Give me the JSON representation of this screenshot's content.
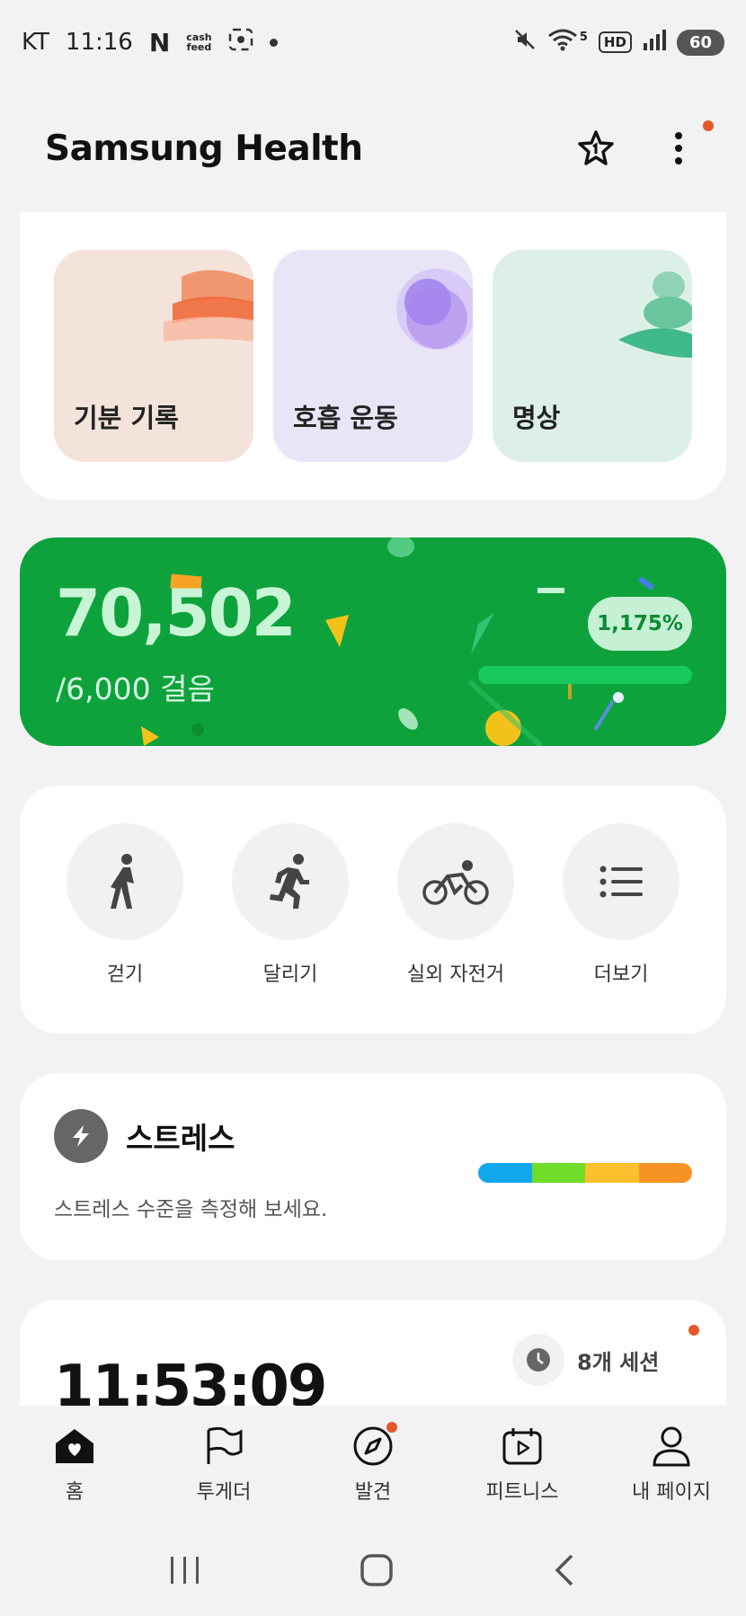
{
  "status_bar": {
    "carrier": "KT",
    "time": "11:16",
    "cashfeed_top": "cash",
    "cashfeed_bottom": "feed",
    "n_logo": "N",
    "hd": "HD",
    "network": "5",
    "battery": "60"
  },
  "header": {
    "title": "Samsung Health"
  },
  "mindfulness": {
    "tiles": [
      {
        "label": "기분 기록"
      },
      {
        "label": "호흡 운동"
      },
      {
        "label": "명상"
      }
    ]
  },
  "steps": {
    "count": "70,502",
    "goal": "/6,000 걸음",
    "percent": "1,175%",
    "progress_fraction": 1.0
  },
  "exercise": {
    "items": [
      {
        "label": "걷기",
        "icon": "walk-icon"
      },
      {
        "label": "달리기",
        "icon": "run-icon"
      },
      {
        "label": "실외 자전거",
        "icon": "bike-icon"
      },
      {
        "label": "더보기",
        "icon": "list-icon"
      }
    ]
  },
  "stress": {
    "title": "스트레스",
    "description": "스트레스 수준을 측정해 보세요.",
    "colors": [
      "#12a8f0",
      "#6fdc2a",
      "#fbc02d",
      "#f79325"
    ]
  },
  "sleep": {
    "time": "11:53:09",
    "sessions": "8개 세션"
  },
  "bottom_nav": {
    "items": [
      {
        "label": "홈"
      },
      {
        "label": "투게더"
      },
      {
        "label": "발견"
      },
      {
        "label": "피트니스"
      },
      {
        "label": "내 페이지"
      }
    ]
  },
  "colors": {
    "accent_green": "#0ea23c",
    "notification": "#e4592a"
  }
}
